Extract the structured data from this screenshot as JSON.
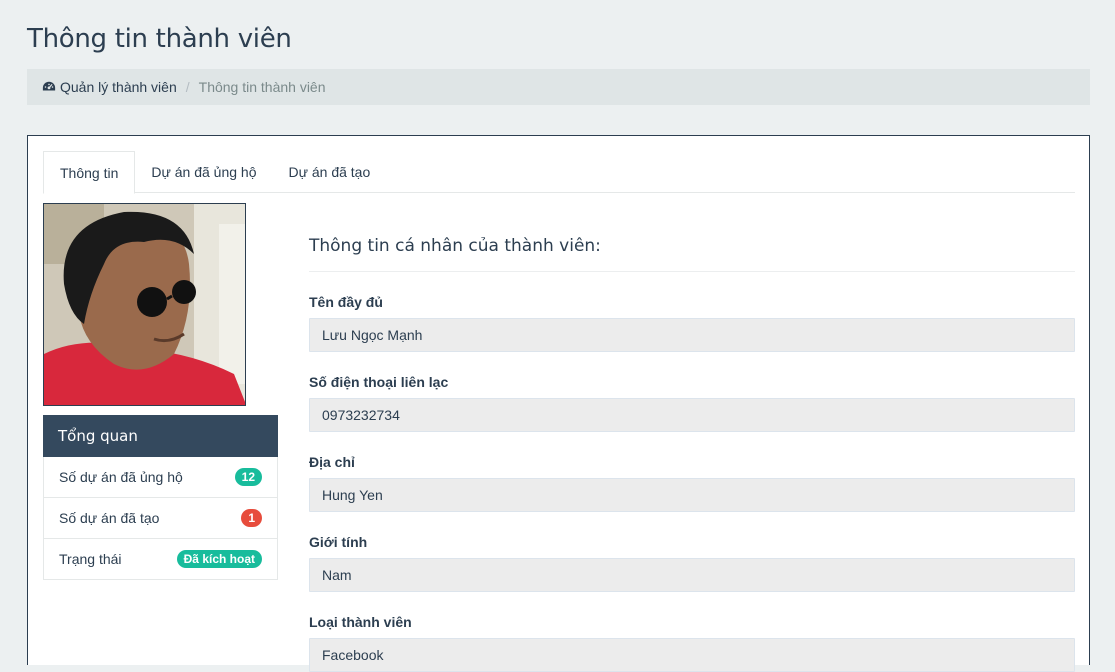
{
  "page": {
    "title": "Thông tin thành viên"
  },
  "breadcrumb": {
    "home_icon": "dashboard-icon",
    "home_label": "Quản lý thành viên",
    "separator": "/",
    "current": "Thông tin thành viên"
  },
  "tabs": [
    {
      "label": "Thông tin",
      "active": true
    },
    {
      "label": "Dự án đã ủng hộ",
      "active": false
    },
    {
      "label": "Dự án đã tạo",
      "active": false
    }
  ],
  "summary": {
    "heading": "Tổng quan",
    "rows": [
      {
        "label": "Số dự án đã ủng hộ",
        "badge": "12",
        "badge_color": "#18bc9c"
      },
      {
        "label": "Số dự án đã tạo",
        "badge": "1",
        "badge_color": "#e74c3c"
      },
      {
        "label": "Trạng thái",
        "badge": "Đã kích hoạt",
        "badge_color": "#18bc9c"
      }
    ]
  },
  "info": {
    "title": "Thông tin cá nhân của thành viên:",
    "fields": [
      {
        "label": "Tên đầy đủ",
        "value": "Lưu Ngọc Mạnh"
      },
      {
        "label": "Số điện thoại liên lạc",
        "value": "0973232734"
      },
      {
        "label": "Địa chỉ",
        "value": "Hung Yen"
      },
      {
        "label": "Giới tính",
        "value": "Nam"
      },
      {
        "label": "Loại thành viên",
        "value": "Facebook"
      }
    ]
  },
  "colors": {
    "page_bg": "#ecf0f1",
    "primary": "#2c3e50",
    "header_dark": "#34495e",
    "success": "#18bc9c",
    "danger": "#e74c3c"
  }
}
